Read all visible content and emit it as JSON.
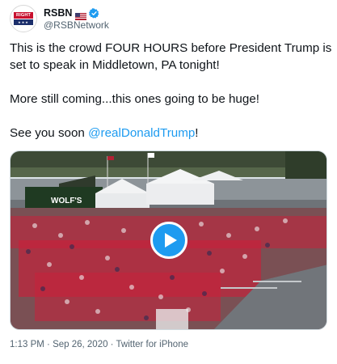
{
  "author": {
    "display_name": "RSBN",
    "handle": "@RSBNetwork",
    "avatar_text": "RIGHT SIDE",
    "flag_icon": "us-flag-icon",
    "verified_icon": "verified-badge-icon"
  },
  "tweet": {
    "line1": "This is the crowd FOUR HOURS before President Trump is set to speak in Middletown, PA tonight!",
    "line2": "More still coming...this ones going to be huge!",
    "line3_prefix": "See you soon ",
    "line3_mention": "@realDonaldTrump",
    "line3_suffix": "!"
  },
  "media": {
    "type": "video",
    "banner_text": "WOLF'S",
    "play_icon": "play-icon"
  },
  "meta": {
    "time": "1:13 PM",
    "date": "Sep 26, 2020",
    "separator": " · ",
    "source": "Twitter for iPhone"
  },
  "colors": {
    "accent": "#1d9bf0",
    "text": "#0f1419",
    "secondary": "#536471"
  }
}
